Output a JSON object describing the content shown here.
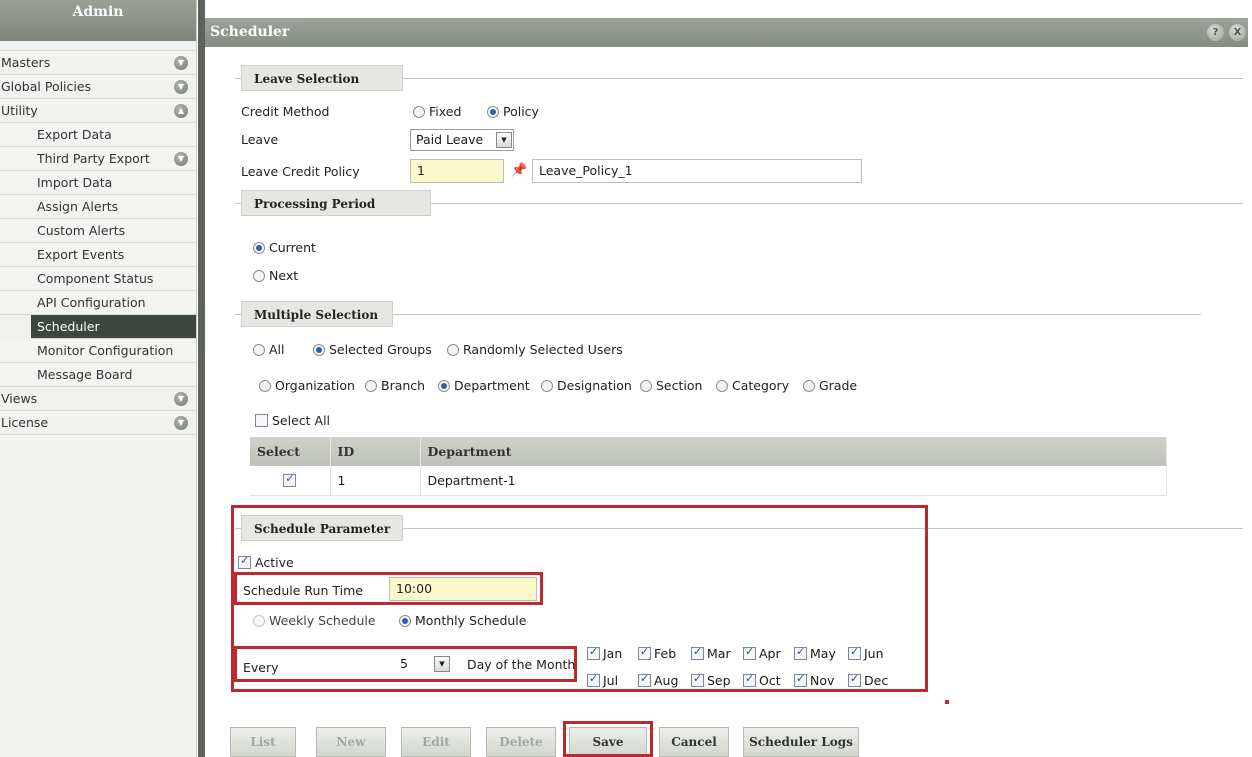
{
  "sidebar": {
    "title": "Admin",
    "items": [
      {
        "label": "Masters"
      },
      {
        "label": "Global Policies"
      },
      {
        "label": "Utility"
      },
      {
        "label": "Export Data"
      },
      {
        "label": "Third Party Export"
      },
      {
        "label": "Import Data"
      },
      {
        "label": "Assign Alerts"
      },
      {
        "label": "Custom Alerts"
      },
      {
        "label": "Export Events"
      },
      {
        "label": "Component Status"
      },
      {
        "label": "API Configuration"
      },
      {
        "label": "Scheduler"
      },
      {
        "label": "Monitor Configuration"
      },
      {
        "label": "Message Board"
      },
      {
        "label": "Views"
      },
      {
        "label": "License"
      }
    ]
  },
  "window": {
    "title": "Scheduler",
    "help": "?",
    "close": "X"
  },
  "leave_selection": {
    "heading": "Leave Selection",
    "credit_method_label": "Credit Method",
    "credit_fixed": "Fixed",
    "credit_policy": "Policy",
    "leave_label": "Leave",
    "leave_value": "Paid Leave",
    "policy_label": "Leave Credit Policy",
    "policy_id": "1",
    "policy_name": "Leave_Policy_1"
  },
  "processing_period": {
    "heading": "Processing Period",
    "current": "Current",
    "next": "Next"
  },
  "multiple_selection": {
    "heading": "Multiple Selection",
    "all": "All",
    "selected_groups": "Selected Groups",
    "random_users": "Randomly Selected Users",
    "group_types": [
      "Organization",
      "Branch",
      "Department",
      "Designation",
      "Section",
      "Category",
      "Grade"
    ],
    "select_all": "Select All",
    "columns": [
      "Select",
      "ID",
      "Department"
    ],
    "rows": [
      {
        "id": "1",
        "department": "Department-1"
      }
    ]
  },
  "schedule": {
    "heading": "Schedule Parameter",
    "active": "Active",
    "run_time_label": "Schedule Run Time",
    "run_time_value": "10:00",
    "weekly": "Weekly Schedule",
    "monthly": "Monthly Schedule",
    "every_label": "Every",
    "every_value": "5",
    "day_of_month": "Day of the Month",
    "months": [
      "Jan",
      "Feb",
      "Mar",
      "Apr",
      "May",
      "Jun",
      "Jul",
      "Aug",
      "Sep",
      "Oct",
      "Nov",
      "Dec"
    ]
  },
  "buttons": {
    "list": "List",
    "new": "New",
    "edit": "Edit",
    "delete": "Delete",
    "save": "Save",
    "cancel": "Cancel",
    "logs": "Scheduler Logs"
  },
  "colors": {
    "accent": "#2d5fa8",
    "highlight": "#c0282f",
    "sidebar_active": "#3e4640"
  }
}
